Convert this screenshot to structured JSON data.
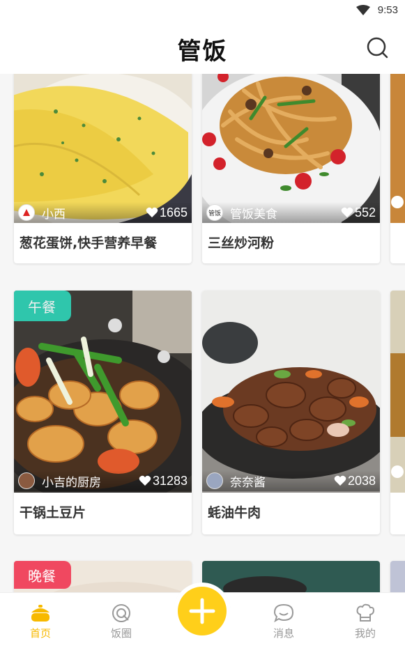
{
  "status_bar": {
    "time": "9:53"
  },
  "header": {
    "title": "管饭"
  },
  "badges": {
    "lunch": "午餐",
    "dinner": "晚餐"
  },
  "feed": {
    "cards": [
      {
        "author": "小西",
        "likes": "1665",
        "title": "葱花蛋饼,快手营养早餐"
      },
      {
        "author": "管饭美食",
        "avatar_text": "管饭",
        "likes": "552",
        "title": "三丝炒河粉"
      },
      {
        "author": "小吉的厨房",
        "likes": "31283",
        "title": "干锅土豆片"
      },
      {
        "author": "奈奈酱",
        "likes": "2038",
        "title": "蚝油牛肉"
      }
    ]
  },
  "nav": {
    "home": "首页",
    "circle": "饭圈",
    "messages": "消息",
    "mine": "我的"
  },
  "colors": {
    "accent": "#ffcf1a",
    "lunch_badge": "#2ed3b7",
    "dinner_badge": "#f04860"
  }
}
